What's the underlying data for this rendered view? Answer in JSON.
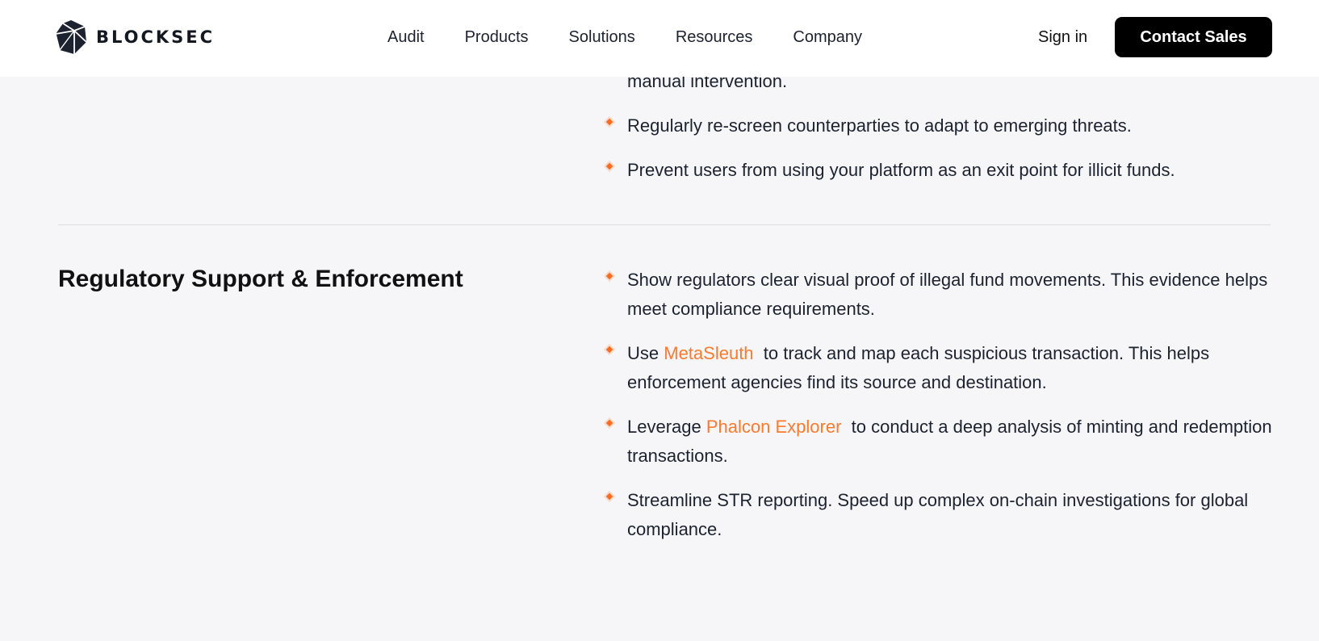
{
  "header": {
    "logo_text": "BLOCKSEC",
    "nav": [
      "Audit",
      "Products",
      "Solutions",
      "Resources",
      "Company"
    ],
    "sign_in": "Sign in",
    "contact": "Contact Sales"
  },
  "top_section": {
    "partial_line": "manual intervention.",
    "items": [
      "Regularly re-screen counterparties to adapt to emerging threats.",
      "Prevent users from using your platform as an exit point for illicit funds."
    ]
  },
  "regulatory": {
    "title": "Regulatory Support & Enforcement",
    "item1": "Show regulators clear visual proof of illegal fund movements. This evidence helps meet compliance requirements.",
    "item2": {
      "before": "Use ",
      "link": "MetaSleuth",
      "after": "  to track and map each suspicious transaction. This helps enforcement agencies find its source and destination."
    },
    "item3": {
      "before": "Leverage ",
      "link": "Phalcon Explorer",
      "after": "  to conduct a deep analysis of minting and redemption transactions."
    },
    "item4": "Streamline STR reporting. Speed up complex on-chain investigations for global compliance."
  },
  "colors": {
    "accent": "#fb7a2c",
    "background": "#f6f6f8",
    "button": "#000000"
  },
  "icons": [
    "blocksec-logo-icon",
    "diamond-bullet-icon"
  ]
}
